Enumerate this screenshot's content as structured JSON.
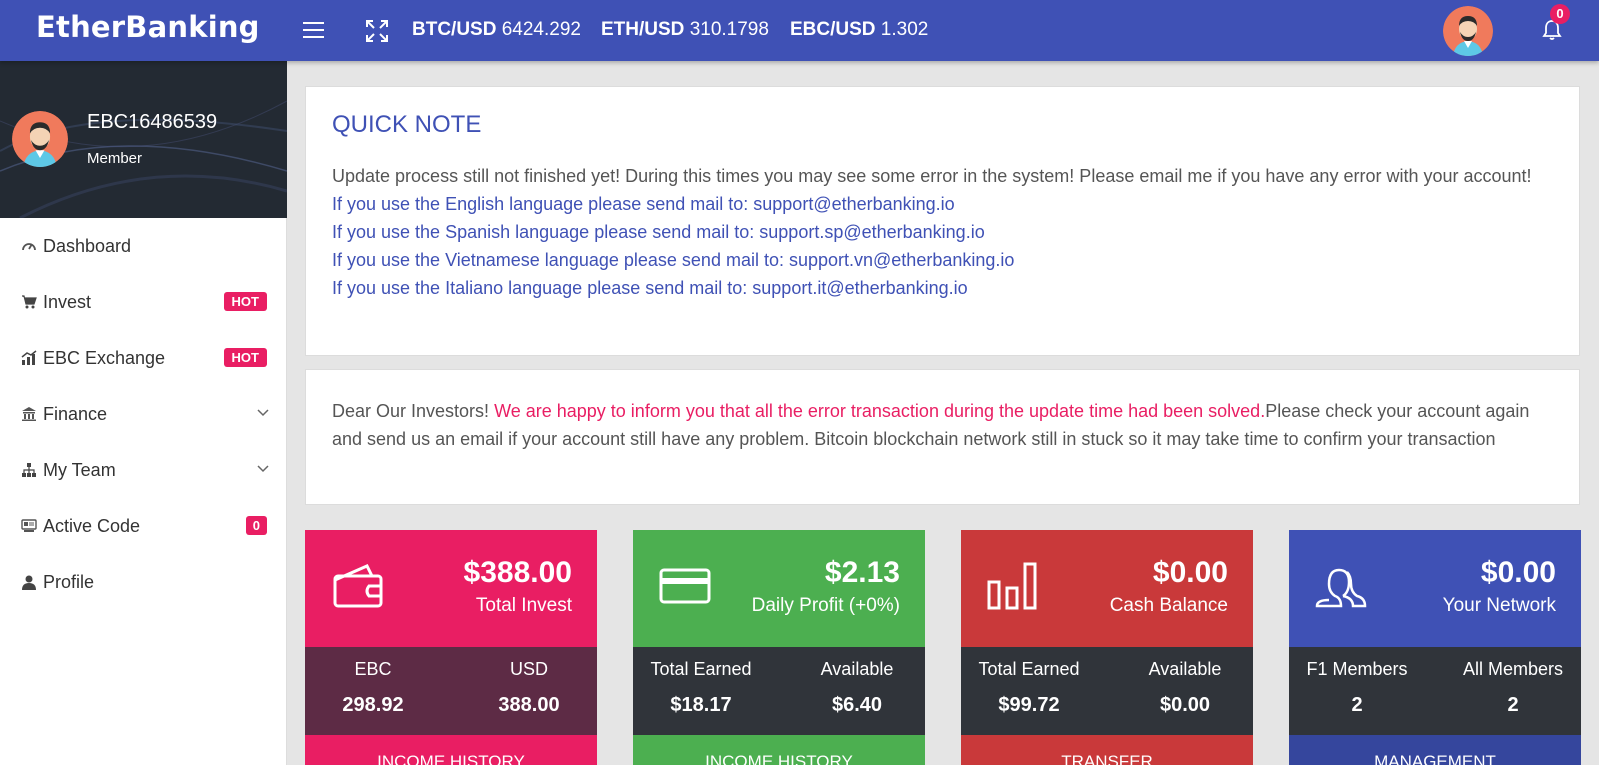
{
  "header": {
    "brand": "EtherBanking",
    "tickers": [
      {
        "pair": "BTC/USD",
        "price": "6424.292"
      },
      {
        "pair": "ETH/USD",
        "price": "310.1798"
      },
      {
        "pair": "EBC/USD",
        "price": "1.302"
      }
    ],
    "notification_count": "0"
  },
  "user": {
    "id": "EBC16486539",
    "role": "Member"
  },
  "sidebar": {
    "items": [
      {
        "label": "Dashboard",
        "icon": "dashboard-icon"
      },
      {
        "label": "Invest",
        "icon": "cart-icon",
        "badge": "HOT"
      },
      {
        "label": "EBC Exchange",
        "icon": "chart-icon",
        "badge": "HOT"
      },
      {
        "label": "Finance",
        "icon": "bank-icon"
      },
      {
        "label": "My Team",
        "icon": "sitemap-icon"
      },
      {
        "label": "Active Code",
        "icon": "code-icon",
        "badge": "0"
      },
      {
        "label": "Profile",
        "icon": "user-icon"
      }
    ]
  },
  "quick_note": {
    "title": "QUICK NOTE",
    "intro": "Update process still not finished yet! During this times you may see some error in the system! Please email me if you have any error with your account!",
    "lines": [
      "If you use the English language please send mail to: support@etherbanking.io",
      "If you use the Spanish language please send mail to: support.sp@etherbanking.io",
      "If you use the Vietnamese language please send mail to: support.vn@etherbanking.io",
      "If you use the Italiano language please send mail to: support.it@etherbanking.io"
    ]
  },
  "announcement": {
    "prefix": "Dear Our Investors! ",
    "highlight": "We are happy to inform you that all the error transaction during the update time had been solved.",
    "suffix": "Please check your account again and send us an email if your account still have any problem. Bitcoin blockchain network still in stuck so it may take time to confirm your transaction"
  },
  "stats": [
    {
      "amount": "$388.00",
      "label": "Total Invest",
      "icon": "wallet-icon",
      "left_label": "EBC",
      "left_value": "298.92",
      "right_label": "USD",
      "right_value": "388.00",
      "action": "INCOME HISTORY",
      "colors": {
        "top": "#e91e63",
        "bottom": "#5d2b45",
        "action": "#e91e63"
      }
    },
    {
      "amount": "$2.13",
      "label": "Daily Profit (+0%)",
      "icon": "credit-card-icon",
      "left_label": "Total Earned",
      "left_value": "$18.17",
      "right_label": "Available",
      "right_value": "$6.40",
      "action": "INCOME HISTORY",
      "colors": {
        "top": "#4caf50",
        "bottom": "#30343a",
        "action": "#4caf50"
      }
    },
    {
      "amount": "$0.00",
      "label": "Cash Balance",
      "icon": "bar-chart-icon",
      "left_label": "Total Earned",
      "left_value": "$99.72",
      "right_label": "Available",
      "right_value": "$0.00",
      "action": "TRANSFER",
      "colors": {
        "top": "#c9393a",
        "bottom": "#30343a",
        "action": "#c9393a"
      }
    },
    {
      "amount": "$0.00",
      "label": "Your Network",
      "icon": "users-icon",
      "left_label": "F1 Members",
      "left_value": "2",
      "right_label": "All Members",
      "right_value": "2",
      "action": "MANAGEMENT",
      "colors": {
        "top": "#3f51b5",
        "bottom": "#30343a",
        "action": "#35469d"
      }
    }
  ]
}
